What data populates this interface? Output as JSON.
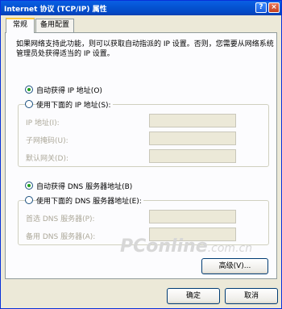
{
  "window": {
    "title": "Internet 协议 (TCP/IP) 属性",
    "help_symbol": "?",
    "close_symbol": "×"
  },
  "tabs": [
    {
      "label": "常规",
      "active": true
    },
    {
      "label": "备用配置",
      "active": false
    }
  ],
  "description": "如果网络支持此功能，则可以获取自动指派的 IP 设置。否则，您需要从网络系统管理员处获得适当的 IP 设置。",
  "ip": {
    "auto_label": "自动获得 IP 地址(O)",
    "auto_checked": true,
    "manual_label": "使用下面的 IP 地址(S):",
    "manual_checked": false,
    "fields": [
      {
        "label": "IP 地址(I):",
        "value": ""
      },
      {
        "label": "子网掩码(U):",
        "value": ""
      },
      {
        "label": "默认网关(D):",
        "value": ""
      }
    ]
  },
  "dns": {
    "auto_label": "自动获得 DNS 服务器地址(B)",
    "auto_checked": true,
    "manual_label": "使用下面的 DNS 服务器地址(E):",
    "manual_checked": false,
    "fields": [
      {
        "label": "首选 DNS 服务器(P):",
        "value": ""
      },
      {
        "label": "备用 DNS 服务器(A):",
        "value": ""
      }
    ]
  },
  "buttons": {
    "advanced": "高级(V)...",
    "ok": "确定",
    "cancel": "取消"
  },
  "watermark": {
    "main": "PConline",
    "suffix": ".com.cn"
  }
}
